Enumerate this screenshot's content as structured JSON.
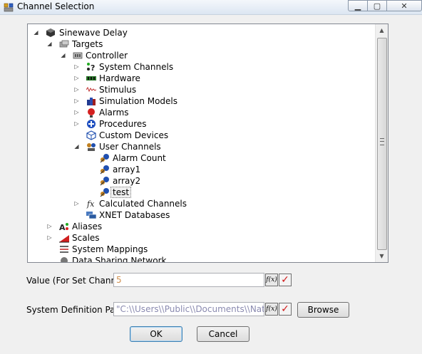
{
  "window": {
    "title": "Channel Selection"
  },
  "tree": {
    "nodes": [
      {
        "label": "Sinewave Delay",
        "icon": "box-icon"
      },
      {
        "label": "Targets",
        "icon": "targets-icon"
      },
      {
        "label": "Controller",
        "icon": "controller-icon"
      },
      {
        "label": "System Channels",
        "icon": "system-channels-icon"
      },
      {
        "label": "Hardware",
        "icon": "hardware-icon"
      },
      {
        "label": "Stimulus",
        "icon": "stimulus-icon"
      },
      {
        "label": "Simulation Models",
        "icon": "simulation-models-icon"
      },
      {
        "label": "Alarms",
        "icon": "alarm-icon"
      },
      {
        "label": "Procedures",
        "icon": "procedures-icon"
      },
      {
        "label": "Custom Devices",
        "icon": "custom-devices-icon"
      },
      {
        "label": "User Channels",
        "icon": "user-channels-icon"
      },
      {
        "label": "Alarm Count",
        "icon": "channel-icon"
      },
      {
        "label": "array1",
        "icon": "channel-icon"
      },
      {
        "label": "array2",
        "icon": "channel-icon"
      },
      {
        "label": "test",
        "icon": "channel-icon"
      },
      {
        "label": "Calculated Channels",
        "icon": "fx-icon"
      },
      {
        "label": "XNET Databases",
        "icon": "xnet-icon"
      },
      {
        "label": "Aliases",
        "icon": "aliases-icon"
      },
      {
        "label": "Scales",
        "icon": "scales-icon"
      },
      {
        "label": "System Mappings",
        "icon": "system-mappings-icon"
      },
      {
        "label": "Data Sharing Network",
        "icon": "network-icon"
      }
    ]
  },
  "value_field": {
    "label": "Value (For Set Channel)",
    "value": "5"
  },
  "path_field": {
    "label": "System Definition Path",
    "value": "\"C:\\\\Users\\\\Public\\\\Documents\\\\National"
  },
  "buttons": {
    "fx": "f(x)",
    "browse": "Browse",
    "ok": "OK",
    "cancel": "Cancel"
  }
}
